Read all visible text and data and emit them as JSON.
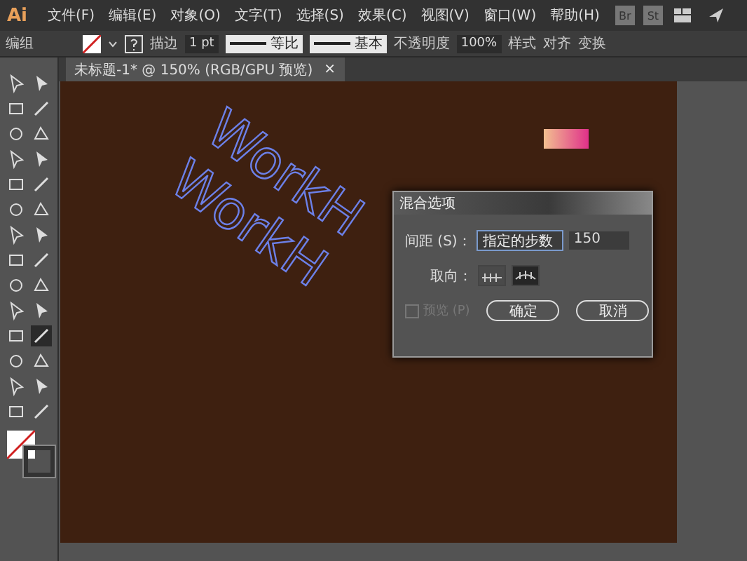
{
  "app": {
    "logo": "Ai",
    "bridge": "Br",
    "stock": "St"
  },
  "menu": [
    "文件(F)",
    "编辑(E)",
    "对象(O)",
    "文字(T)",
    "选择(S)",
    "效果(C)",
    "视图(V)",
    "窗口(W)",
    "帮助(H)"
  ],
  "control_bar": {
    "selection": "编组",
    "stroke_label": "描边",
    "stroke_value": "1 pt",
    "profile": "等比",
    "brush": "基本",
    "opacity_label": "不透明度",
    "opacity": "100%",
    "style_label": "样式",
    "align": "对齐",
    "transform": "变换"
  },
  "tab": {
    "title": "未标题-1* @ 150% (RGB/GPU 预览)",
    "close": "×"
  },
  "artwork": [
    {
      "text": "WorkH"
    },
    {
      "text": "WorkH"
    }
  ],
  "dialog": {
    "title": "混合选项",
    "spacing_label": "间距 (S)：",
    "spacing_mode": "指定的步数",
    "spacing_value": "150",
    "orientation_label": "取向：",
    "orientation": [
      {
        "kind": "page",
        "selected": false
      },
      {
        "kind": "path",
        "selected": true
      }
    ],
    "preview": {
      "label": "预览 (P)",
      "checked": false,
      "disabled": true
    },
    "buttons": [
      "确定",
      "取消"
    ]
  }
}
